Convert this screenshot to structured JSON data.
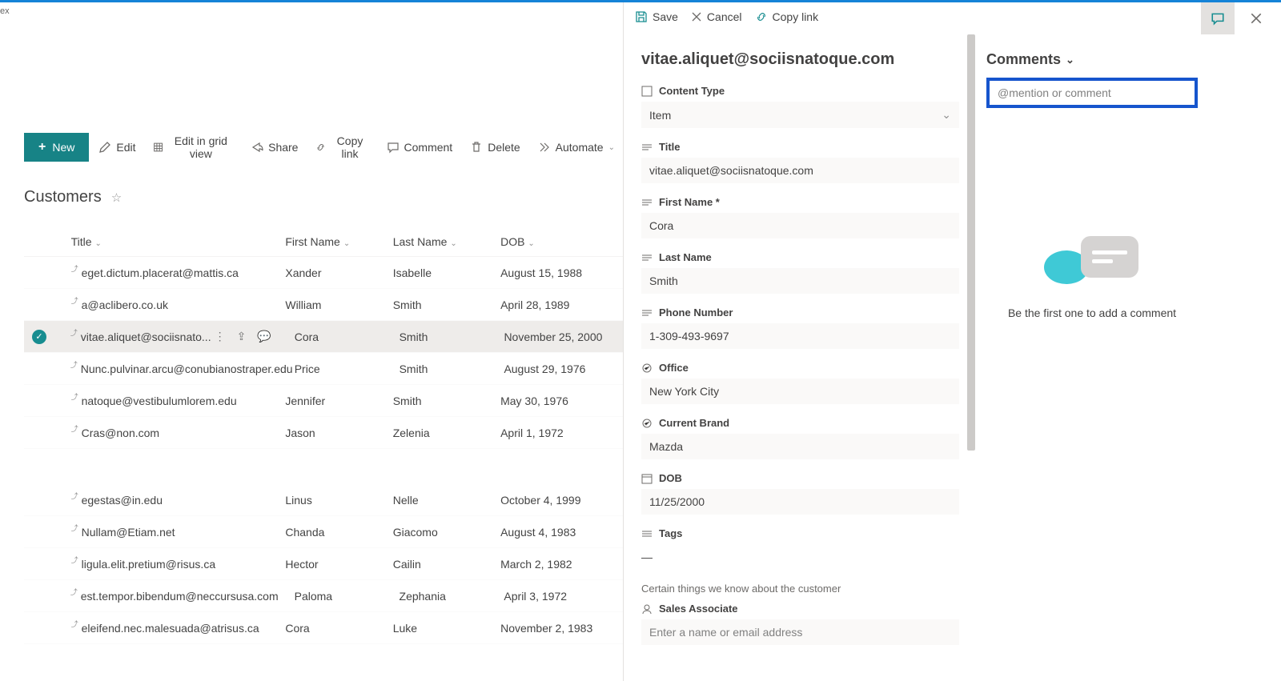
{
  "tab": "ex",
  "toolbar": {
    "new_label": "New",
    "edit_label": "Edit",
    "grid_label": "Edit in grid view",
    "share_label": "Share",
    "copylink_label": "Copy link",
    "comment_label": "Comment",
    "delete_label": "Delete",
    "automate_label": "Automate"
  },
  "list": {
    "title": "Customers",
    "columns": {
      "title": "Title",
      "first": "First Name",
      "last": "Last Name",
      "dob": "DOB"
    },
    "rows": [
      {
        "title": "eget.dictum.placerat@mattis.ca",
        "first": "Xander",
        "last": "Isabelle",
        "dob": "August 15, 1988",
        "selected": false
      },
      {
        "title": "a@aclibero.co.uk",
        "first": "William",
        "last": "Smith",
        "dob": "April 28, 1989",
        "selected": false
      },
      {
        "title": "vitae.aliquet@sociisnato...",
        "first": "Cora",
        "last": "Smith",
        "dob": "November 25, 2000",
        "selected": true
      },
      {
        "title": "Nunc.pulvinar.arcu@conubianostraper.edu",
        "first": "Price",
        "last": "Smith",
        "dob": "August 29, 1976",
        "selected": false
      },
      {
        "title": "natoque@vestibulumlorem.edu",
        "first": "Jennifer",
        "last": "Smith",
        "dob": "May 30, 1976",
        "selected": false
      },
      {
        "title": "Cras@non.com",
        "first": "Jason",
        "last": "Zelenia",
        "dob": "April 1, 1972",
        "selected": false
      }
    ],
    "rows2": [
      {
        "title": "egestas@in.edu",
        "first": "Linus",
        "last": "Nelle",
        "dob": "October 4, 1999"
      },
      {
        "title": "Nullam@Etiam.net",
        "first": "Chanda",
        "last": "Giacomo",
        "dob": "August 4, 1983"
      },
      {
        "title": "ligula.elit.pretium@risus.ca",
        "first": "Hector",
        "last": "Cailin",
        "dob": "March 2, 1982"
      },
      {
        "title": "est.tempor.bibendum@neccursusa.com",
        "first": "Paloma",
        "last": "Zephania",
        "dob": "April 3, 1972"
      },
      {
        "title": "eleifend.nec.malesuada@atrisus.ca",
        "first": "Cora",
        "last": "Luke",
        "dob": "November 2, 1983"
      }
    ]
  },
  "panel": {
    "save_label": "Save",
    "cancel_label": "Cancel",
    "copylink_label": "Copy link",
    "title": "vitae.aliquet@sociisnatoque.com",
    "fields": {
      "content_type": {
        "label": "Content Type",
        "value": "Item"
      },
      "title": {
        "label": "Title",
        "value": "vitae.aliquet@sociisnatoque.com"
      },
      "first_name": {
        "label": "First Name *",
        "value": "Cora"
      },
      "last_name": {
        "label": "Last Name",
        "value": "Smith"
      },
      "phone": {
        "label": "Phone Number",
        "value": "1-309-493-9697"
      },
      "office": {
        "label": "Office",
        "value": "New York City"
      },
      "brand": {
        "label": "Current Brand",
        "value": "Mazda"
      },
      "dob": {
        "label": "DOB",
        "value": "11/25/2000"
      },
      "tags": {
        "label": "Tags",
        "value": "—"
      },
      "section_text": "Certain things we know about the customer",
      "sales_assoc": {
        "label": "Sales Associate",
        "placeholder": "Enter a name or email address"
      }
    }
  },
  "comments": {
    "header": "Comments",
    "placeholder": "@mention or comment",
    "empty_text": "Be the first one to add a comment"
  }
}
